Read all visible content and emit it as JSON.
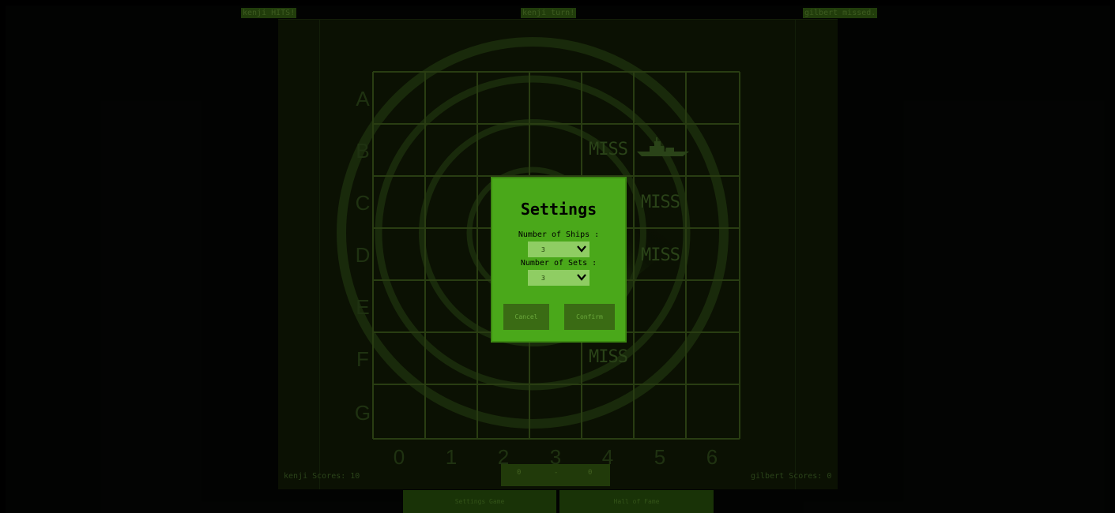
{
  "status": {
    "left": "kenji HITS!",
    "center": "kenji turn!",
    "right": "gilbert missed."
  },
  "board": {
    "rows": [
      "A",
      "B",
      "C",
      "D",
      "E",
      "F",
      "G"
    ],
    "cols": [
      "0",
      "1",
      "2",
      "3",
      "4",
      "5",
      "6"
    ],
    "markers": [
      {
        "row": "B",
        "col": "4",
        "text": "MISS"
      },
      {
        "row": "C",
        "col": "5",
        "text": "MISS"
      },
      {
        "row": "D",
        "col": "5",
        "text": "MISS"
      },
      {
        "row": "F",
        "col": "4",
        "text": "MISS"
      }
    ],
    "ship_icon": "battleship-icon"
  },
  "scores": {
    "left_label": "kenji Scores: 10",
    "right_label": "gilbert Scores: 0",
    "tally": {
      "left": "0",
      "sep": "-",
      "right": "0"
    }
  },
  "buttons": {
    "settings_game": "Settings Game",
    "hall_of_fame": "Hall of Fame"
  },
  "modal": {
    "title": "Settings",
    "ships_label": "Number of Ships :",
    "ships_value": "3",
    "sets_label": "Number of Sets :",
    "sets_value": "3",
    "cancel": "Cancel",
    "confirm": "Confirm"
  },
  "colors": {
    "radar_green": "#1d3a0c",
    "panel_green": "#4aa81a",
    "text_green": "#3a5c1f"
  }
}
